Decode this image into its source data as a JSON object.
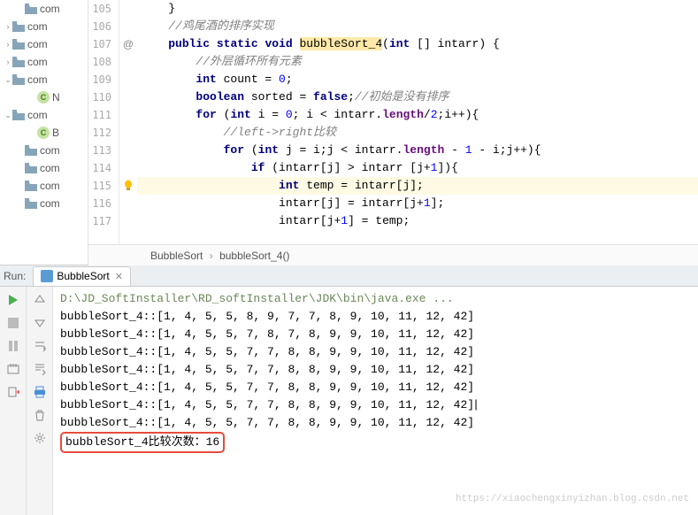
{
  "tree": {
    "items": [
      {
        "indent": 18,
        "arrow": "",
        "kind": "folder",
        "label": "com"
      },
      {
        "indent": 4,
        "arrow": "›",
        "kind": "folder",
        "label": "com"
      },
      {
        "indent": 4,
        "arrow": "›",
        "kind": "folder",
        "label": "com"
      },
      {
        "indent": 4,
        "arrow": "›",
        "kind": "folder",
        "label": "com"
      },
      {
        "indent": 4,
        "arrow": "⌄",
        "kind": "folder",
        "label": "com"
      },
      {
        "indent": 32,
        "arrow": "",
        "kind": "class",
        "label": "N"
      },
      {
        "indent": 4,
        "arrow": "⌄",
        "kind": "folder",
        "label": "com"
      },
      {
        "indent": 32,
        "arrow": "",
        "kind": "class",
        "label": "B"
      },
      {
        "indent": 18,
        "arrow": "",
        "kind": "folder",
        "label": "com"
      },
      {
        "indent": 18,
        "arrow": "",
        "kind": "folder",
        "label": "com"
      },
      {
        "indent": 18,
        "arrow": "",
        "kind": "folder",
        "label": "com"
      },
      {
        "indent": 18,
        "arrow": "",
        "kind": "folder",
        "label": "com"
      }
    ]
  },
  "editor": {
    "gutter_marks": {
      "107": "@",
      "115": "bulb"
    },
    "lines": [
      {
        "n": 105,
        "ind": 2,
        "t": [
          {
            "c": "",
            "s": "}"
          }
        ]
      },
      {
        "n": 106,
        "ind": 2,
        "t": [
          {
            "c": "str-cmt",
            "s": "//鸡尾酒的排序实现"
          }
        ]
      },
      {
        "n": 107,
        "ind": 2,
        "t": [
          {
            "c": "kw",
            "s": "public"
          },
          {
            "c": "",
            "s": " "
          },
          {
            "c": "kw",
            "s": "static"
          },
          {
            "c": "",
            "s": " "
          },
          {
            "c": "kw",
            "s": "void"
          },
          {
            "c": "",
            "s": " "
          },
          {
            "c": "mname",
            "s": "bubbleSort_4"
          },
          {
            "c": "",
            "s": "("
          },
          {
            "c": "kw",
            "s": "int"
          },
          {
            "c": "",
            "s": " [] intarr) {"
          }
        ]
      },
      {
        "n": 108,
        "ind": 4,
        "t": [
          {
            "c": "str-cmt",
            "s": "//外层循环所有元素"
          }
        ]
      },
      {
        "n": 109,
        "ind": 4,
        "t": [
          {
            "c": "kw",
            "s": "int"
          },
          {
            "c": "",
            "s": " count = "
          },
          {
            "c": "num",
            "s": "0"
          },
          {
            "c": "",
            "s": ";"
          }
        ]
      },
      {
        "n": 110,
        "ind": 4,
        "t": [
          {
            "c": "kw",
            "s": "boolean"
          },
          {
            "c": "",
            "s": " sorted = "
          },
          {
            "c": "kw",
            "s": "false"
          },
          {
            "c": "",
            "s": ";"
          },
          {
            "c": "str-cmt",
            "s": "//初始是没有排序"
          }
        ]
      },
      {
        "n": 111,
        "ind": 4,
        "t": [
          {
            "c": "kw",
            "s": "for"
          },
          {
            "c": "",
            "s": " ("
          },
          {
            "c": "kw",
            "s": "int"
          },
          {
            "c": "",
            "s": " i = "
          },
          {
            "c": "num",
            "s": "0"
          },
          {
            "c": "",
            "s": "; i < intarr."
          },
          {
            "c": "field",
            "s": "length"
          },
          {
            "c": "",
            "s": "/"
          },
          {
            "c": "num",
            "s": "2"
          },
          {
            "c": "",
            "s": ";i++){"
          }
        ]
      },
      {
        "n": 112,
        "ind": 6,
        "t": [
          {
            "c": "str-cmt",
            "s": "//left->right比较"
          }
        ]
      },
      {
        "n": 113,
        "ind": 6,
        "t": [
          {
            "c": "kw",
            "s": "for"
          },
          {
            "c": "",
            "s": " ("
          },
          {
            "c": "kw",
            "s": "int"
          },
          {
            "c": "",
            "s": " j = i;j < intarr."
          },
          {
            "c": "field",
            "s": "length"
          },
          {
            "c": "",
            "s": " - "
          },
          {
            "c": "num",
            "s": "1"
          },
          {
            "c": "",
            "s": " - i;j++){"
          }
        ]
      },
      {
        "n": 114,
        "ind": 8,
        "t": [
          {
            "c": "kw",
            "s": "if"
          },
          {
            "c": "",
            "s": " (intarr[j] > intarr [j+"
          },
          {
            "c": "num",
            "s": "1"
          },
          {
            "c": "",
            "s": "]){"
          }
        ]
      },
      {
        "n": 115,
        "ind": 10,
        "hl": true,
        "t": [
          {
            "c": "kw",
            "s": "int"
          },
          {
            "c": "",
            "s": " temp = intarr[j];"
          }
        ]
      },
      {
        "n": 116,
        "ind": 10,
        "t": [
          {
            "c": "",
            "s": "intarr[j] = intarr[j+"
          },
          {
            "c": "num",
            "s": "1"
          },
          {
            "c": "",
            "s": "];"
          }
        ]
      },
      {
        "n": 117,
        "ind": 10,
        "t": [
          {
            "c": "",
            "s": "intarr[j+"
          },
          {
            "c": "num",
            "s": "1"
          },
          {
            "c": "",
            "s": "] = temp;"
          }
        ]
      }
    ]
  },
  "breadcrumb": {
    "a": "BubbleSort",
    "b": "bubbleSort_4()"
  },
  "run": {
    "label": "Run:",
    "tab": "BubbleSort",
    "exe": "D:\\JD_SoftInstaller\\RD_softInstaller\\JDK\\bin\\java.exe ...",
    "rows": [
      "bubbleSort_4::[1, 4, 5, 5, 8, 9, 7, 7, 8, 9, 10, 11, 12, 42]",
      "bubbleSort_4::[1, 4, 5, 5, 7, 8, 7, 8, 9, 9, 10, 11, 12, 42]",
      "bubbleSort_4::[1, 4, 5, 5, 7, 7, 8, 8, 9, 9, 10, 11, 12, 42]",
      "bubbleSort_4::[1, 4, 5, 5, 7, 7, 8, 8, 9, 9, 10, 11, 12, 42]",
      "bubbleSort_4::[1, 4, 5, 5, 7, 7, 8, 8, 9, 9, 10, 11, 12, 42]",
      "bubbleSort_4::[1, 4, 5, 5, 7, 7, 8, 8, 9, 9, 10, 11, 12, 42]",
      "bubbleSort_4::[1, 4, 5, 5, 7, 7, 8, 8, 9, 9, 10, 11, 12, 42]"
    ],
    "summary": "bubbleSort_4比较次数：16"
  },
  "watermark": "https://xiaochengxinyizhan.blog.csdn.net"
}
